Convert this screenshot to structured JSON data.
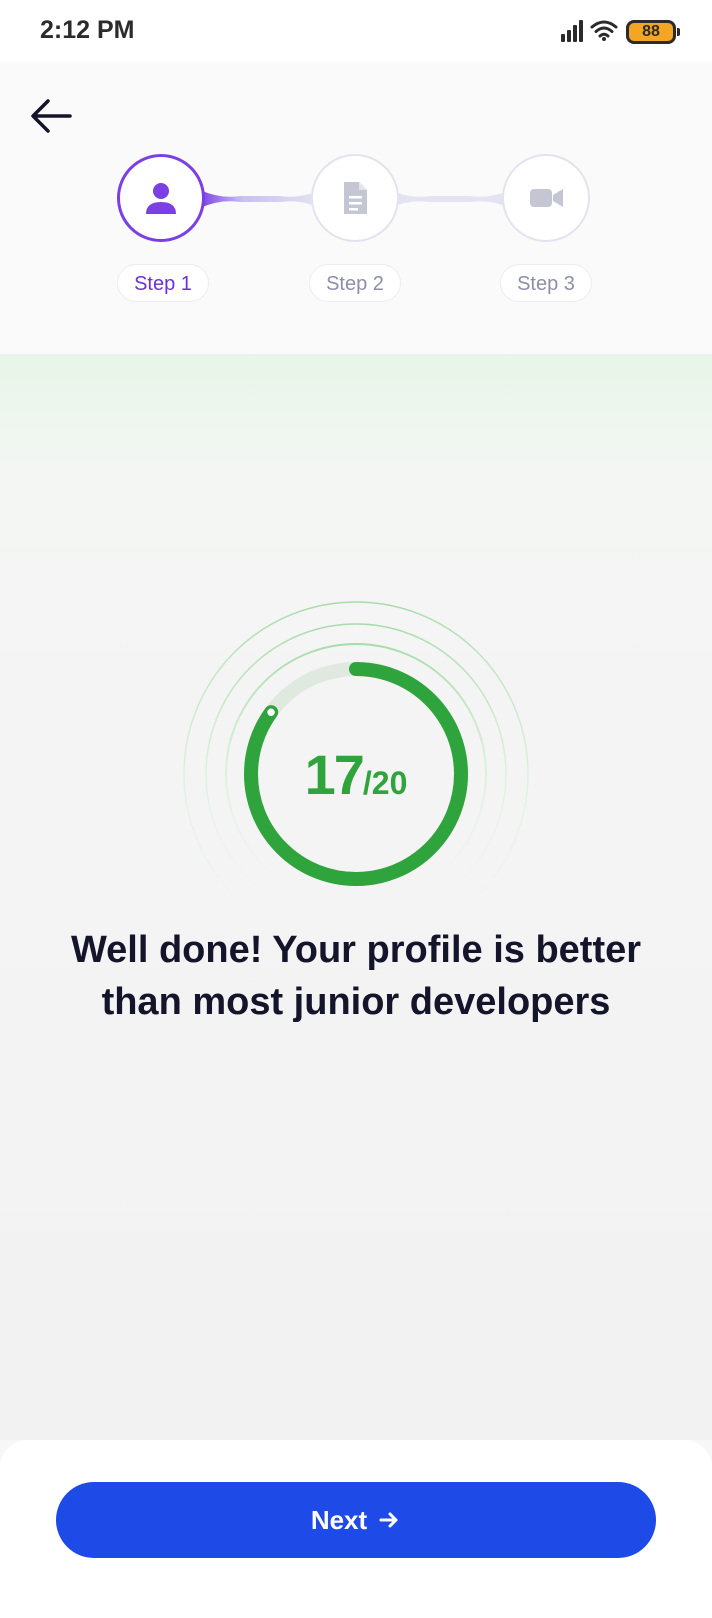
{
  "status_bar": {
    "time": "2:12 PM",
    "battery_level": "88",
    "signal_icon": "signal-icon",
    "wifi_icon": "wifi-icon"
  },
  "header": {
    "back_icon": "arrow-left-icon",
    "steps": [
      {
        "label": "Step 1",
        "icon": "user-icon",
        "state": "active"
      },
      {
        "label": "Step 2",
        "icon": "document-icon",
        "state": "inactive"
      },
      {
        "label": "Step 3",
        "icon": "video-camera-icon",
        "state": "inactive"
      }
    ]
  },
  "score": {
    "value": "17",
    "total": "/20",
    "progress_fraction": 0.85
  },
  "message": "Well done! Your profile is better than most junior developers",
  "footer": {
    "next_label": "Next",
    "next_icon": "arrow-right-icon"
  },
  "colors": {
    "active_step": "#7b3fe4",
    "score_green": "#2fa33c",
    "primary_button": "#1e4ae8"
  }
}
